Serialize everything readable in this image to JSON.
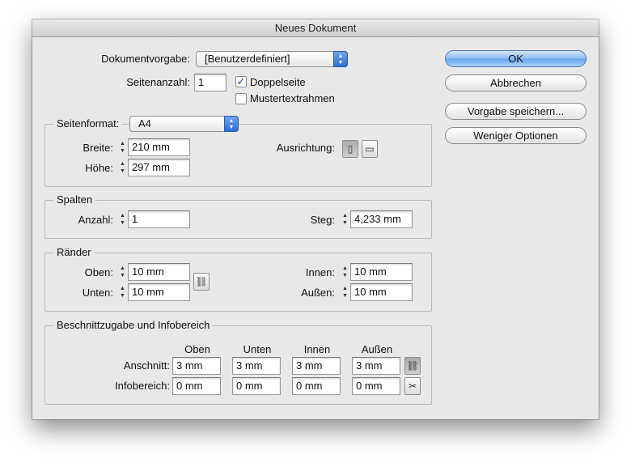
{
  "window": {
    "title": "Neues Dokument"
  },
  "doc": {
    "preset_label": "Dokumentvorgabe:",
    "preset_value": "[Benutzerdefiniert]",
    "pages_label": "Seitenanzahl:",
    "pages_value": "1",
    "facing_label": "Doppelseite",
    "facing_checked": true,
    "master_label": "Mustertextrahmen",
    "master_checked": false
  },
  "buttons": {
    "ok": "OK",
    "cancel": "Abbrechen",
    "save_preset": "Vorgabe speichern...",
    "fewer_options": "Weniger Optionen"
  },
  "page_size": {
    "group_label": "Seitenformat:",
    "format_value": "A4",
    "width_label": "Breite:",
    "width_value": "210 mm",
    "height_label": "Höhe:",
    "height_value": "297 mm",
    "orientation_label": "Ausrichtung:"
  },
  "columns": {
    "group_label": "Spalten",
    "count_label": "Anzahl:",
    "count_value": "1",
    "gutter_label": "Steg:",
    "gutter_value": "4,233 mm"
  },
  "margins": {
    "group_label": "Ränder",
    "top_label": "Oben:",
    "top_value": "10 mm",
    "bottom_label": "Unten:",
    "bottom_value": "10 mm",
    "inside_label": "Innen:",
    "inside_value": "10 mm",
    "outside_label": "Außen:",
    "outside_value": "10 mm"
  },
  "bleed": {
    "group_label": "Beschnittzugabe und Infobereich",
    "headers": [
      "Oben",
      "Unten",
      "Innen",
      "Außen"
    ],
    "bleed_label": "Anschnitt:",
    "bleed_values": [
      "3 mm",
      "3 mm",
      "3 mm",
      "3 mm"
    ],
    "slug_label": "Infobereich:",
    "slug_values": [
      "0 mm",
      "0 mm",
      "0 mm",
      "0 mm"
    ]
  },
  "icons": {
    "spinner": "stepper-arrows-icon",
    "popup_arrows": "popup-arrows-icon",
    "portrait": "portrait-orientation-icon",
    "landscape": "landscape-orientation-icon",
    "chain": "chain-link-icon",
    "chain_broken": "chain-broken-icon"
  }
}
